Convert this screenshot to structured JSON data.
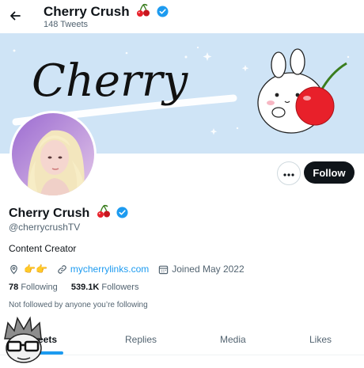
{
  "header": {
    "display_name": "Cherry Crush",
    "tweet_count": "148 Tweets",
    "name_emoji": "cherries-emoji",
    "verified_icon": "verified-badge-icon"
  },
  "banner": {
    "script_text": "Cherry",
    "illustration": "bunny-with-cherry"
  },
  "profile": {
    "display_name": "Cherry Crush",
    "handle": "@cherrycrushTV",
    "bio": "Content Creator",
    "location_emoji": "👉👉",
    "website": "mycherrylinks.com",
    "joined": "Joined May 2022",
    "following_count": "78",
    "following_label": "Following",
    "followers_count": "539.1K",
    "followers_label": "Followers",
    "not_followed_text": "Not followed by anyone you’re following"
  },
  "actions": {
    "follow_label": "Follow"
  },
  "tabs": [
    {
      "label": "Tweets",
      "active": true
    },
    {
      "label": "Replies",
      "active": false
    },
    {
      "label": "Media",
      "active": false
    },
    {
      "label": "Likes",
      "active": false
    }
  ],
  "overlay": {
    "tweets_tab_visible_text": "eets"
  },
  "colors": {
    "accent": "#1d9bf0",
    "banner_bg": "#cfe4f6",
    "follow_bg": "#0f1419",
    "cherry_red": "#e8202a"
  }
}
